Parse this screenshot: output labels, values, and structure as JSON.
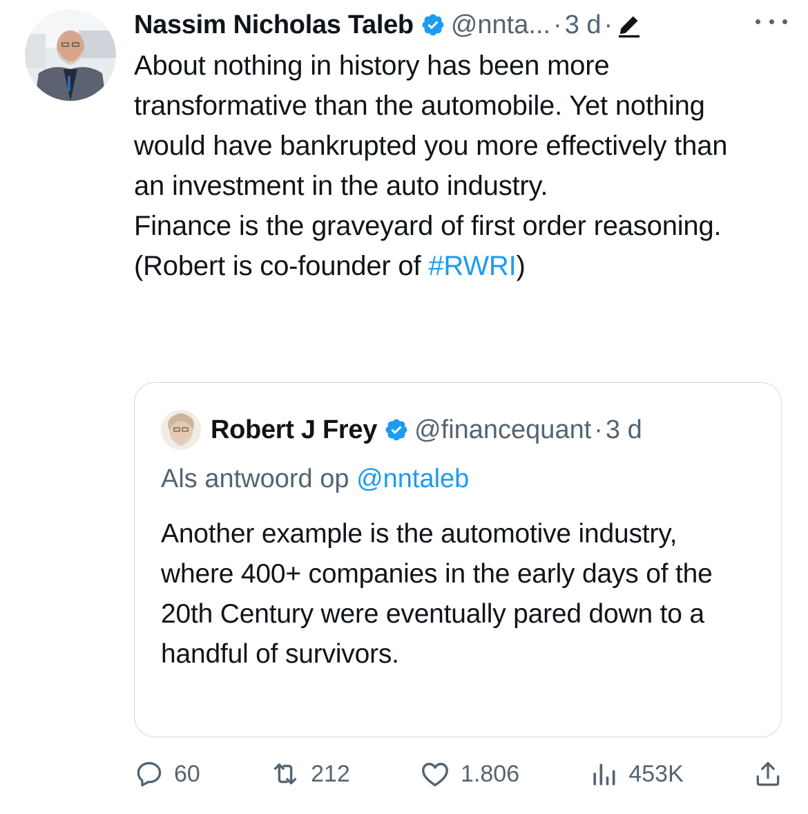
{
  "tweet": {
    "author": {
      "name": "Nassim Nicholas Taleb",
      "handle": "@nnta...",
      "time": "3 d",
      "verified": true
    },
    "text_lines": [
      "About nothing in history has been more transformative than the automobile. Yet nothing would have bankrupted you more effectively than an investment in the auto industry.",
      "Finance is the graveyard of first order reasoning."
    ],
    "final_line_prefix": "(Robert is co-founder of ",
    "hashtag": "#RWRI",
    "final_line_suffix": ")"
  },
  "quoted_tweet": {
    "author": {
      "name": "Robert J Frey",
      "handle": "@financequant",
      "time": "3 d",
      "verified": true
    },
    "reply_prefix": "Als antwoord op ",
    "reply_mention": "@nntaleb",
    "text": "Another example is the automotive industry, where 400+ companies in the early days of the 20th Century were eventually pared down to a handful of survivors."
  },
  "actions": {
    "replies": "60",
    "retweets": "212",
    "likes": "1.806",
    "views": "453K"
  },
  "colors": {
    "text": "#0f1419",
    "muted": "#536471",
    "accent": "#1d9bf0",
    "border": "#cfd9de"
  },
  "icons": [
    "verified-badge-icon",
    "edit-pencil-icon",
    "more-options-icon",
    "reply-icon",
    "retweet-icon",
    "like-icon",
    "views-icon",
    "share-icon"
  ]
}
